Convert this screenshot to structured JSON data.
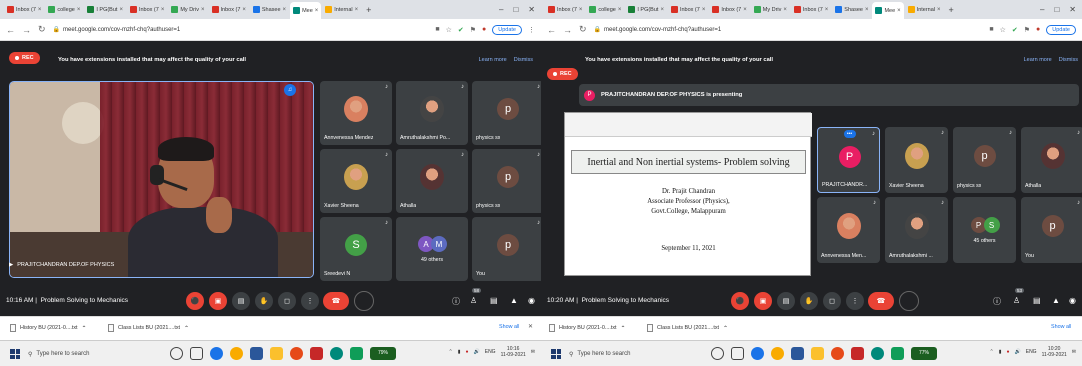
{
  "left": {
    "tabs": [
      {
        "label": "Inbox (7",
        "color": "#d93025",
        "icon": "gmail-icon"
      },
      {
        "label": "college",
        "color": "#34a853",
        "icon": "drive-icon"
      },
      {
        "label": "I PG(But",
        "color": "#188038",
        "icon": "sheets-icon"
      },
      {
        "label": "Inbox (7",
        "color": "#d93025",
        "icon": "gmail-icon"
      },
      {
        "label": "My Driv",
        "color": "#34a853",
        "icon": "drive-icon"
      },
      {
        "label": "Inbox (7",
        "color": "#d93025",
        "icon": "gmail-icon"
      },
      {
        "label": "Shasee",
        "color": "#1a73e8",
        "icon": "docs-icon"
      },
      {
        "label": "Mee",
        "color": "#00897b",
        "icon": "meet-icon",
        "active": true
      },
      {
        "label": "Internal",
        "color": "#f9ab00",
        "icon": "sheets-icon"
      }
    ],
    "new_tab": "+",
    "url": "meet.google.com/cov-mzhf-chq?authuser=1",
    "update": "Update",
    "rec": "REC",
    "notice": "You have extensions installed that may affect the quality of your call",
    "learn_more": "Learn more",
    "dismiss": "Dismiss",
    "speaker_name": "PRAJITCHANDRAN DEP.OF PHYSICS",
    "tiles": [
      {
        "name": "Annvenessa Mendez",
        "kind": "photo",
        "color": "#d98060"
      },
      {
        "name": "Amruthalakshmi Po...",
        "kind": "photo",
        "color": "#444"
      },
      {
        "name": "physics sx",
        "kind": "letter",
        "letter": "p",
        "color": "#6d4c41"
      },
      {
        "name": "Xavier Sheena",
        "kind": "photo",
        "color": "#c8a050"
      },
      {
        "name": "Athalla",
        "kind": "photo",
        "color": "#553333"
      },
      {
        "name": "physics sx",
        "kind": "letter",
        "letter": "p",
        "color": "#6d4c41"
      },
      {
        "name": "Sreedevi N",
        "kind": "letter",
        "letter": "S",
        "color": "#43a047"
      },
      {
        "name": "49 others",
        "kind": "others",
        "letters": [
          "A",
          "M"
        ],
        "colors": [
          "#7e57c2",
          "#5c6bc0"
        ]
      },
      {
        "name": "You",
        "kind": "letter",
        "letter": "p",
        "color": "#6d4c41"
      }
    ],
    "time": "10:16 AM",
    "meeting": "Problem Solving to Mechanics",
    "participants_badge": "58",
    "downloads": [
      "History BU (2021-0....txt",
      "Class Lists BU (2021....txt"
    ],
    "show_all": "Show all",
    "search": "Type here to search",
    "tray_lang": "ENG",
    "clock_time": "10:16",
    "clock_date": "11-09-2021",
    "tray_num": "79%"
  },
  "right": {
    "tabs": [
      {
        "label": "Inbox (7",
        "color": "#d93025",
        "icon": "gmail-icon"
      },
      {
        "label": "college",
        "color": "#34a853",
        "icon": "drive-icon"
      },
      {
        "label": "I PG(But",
        "color": "#188038",
        "icon": "sheets-icon"
      },
      {
        "label": "Inbox (7",
        "color": "#d93025",
        "icon": "gmail-icon"
      },
      {
        "label": "Inbox (7",
        "color": "#d93025",
        "icon": "gmail-icon"
      },
      {
        "label": "My Driv",
        "color": "#34a853",
        "icon": "drive-icon"
      },
      {
        "label": "Inbox (7",
        "color": "#d93025",
        "icon": "gmail-icon"
      },
      {
        "label": "Shasee",
        "color": "#1a73e8",
        "icon": "docs-icon"
      },
      {
        "label": "Mee",
        "color": "#00897b",
        "icon": "meet-icon",
        "active": true
      },
      {
        "label": "Internal",
        "color": "#f9ab00",
        "icon": "sheets-icon"
      }
    ],
    "new_tab": "+",
    "url": "meet.google.com/cov-mzhf-chq?authuser=1",
    "update": "Update",
    "rec": "REC",
    "notice": "You have extensions installed that may affect the quality of your call",
    "learn_more": "Learn more",
    "dismiss": "Dismiss",
    "presenting_letter": "P",
    "presenting": "PRAJITCHANDRAN DEP.OF PHYSICS is presenting",
    "slide": {
      "title": "Inertial and Non inertial systems- Problem solving",
      "line1": "Dr. Prajit Chandran",
      "line2": "Associate Professor (Physics),",
      "line3": "Govt.College, Malappuram",
      "date": "September 11, 2021"
    },
    "tiles": [
      {
        "name": "PRAJITCHANDR...",
        "kind": "letter",
        "letter": "P",
        "color": "#e91e63",
        "highlight": true
      },
      {
        "name": "Xavier Sheena",
        "kind": "photo",
        "color": "#c8a050"
      },
      {
        "name": "physics sx",
        "kind": "letter",
        "letter": "p",
        "color": "#6d4c41"
      },
      {
        "name": "Athalla",
        "kind": "photo",
        "color": "#553333"
      },
      {
        "name": "Annvenessa Men...",
        "kind": "photo",
        "color": "#d98060"
      },
      {
        "name": "Amruthalakshmi ...",
        "kind": "photo",
        "color": "#444"
      },
      {
        "name": "45 others",
        "kind": "others",
        "letters": [
          "P",
          "S"
        ],
        "colors": [
          "#6d4c41",
          "#43a047"
        ]
      },
      {
        "name": "You",
        "kind": "letter",
        "letter": "p",
        "color": "#6d4c41"
      }
    ],
    "time": "10:20 AM",
    "meeting": "Problem Solving to Mechanics",
    "participants_badge": "53",
    "downloads": [
      "History BU (2021-0....txt",
      "Class Lists BU (2021....txt"
    ],
    "show_all": "Show all",
    "search": "Type here to search",
    "tray_lang": "ENG",
    "clock_time": "10:20",
    "clock_date": "11-09-2021",
    "tray_num": "77%"
  }
}
